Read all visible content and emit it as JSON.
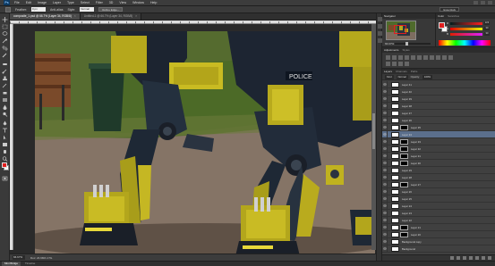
{
  "app": {
    "logo": "Ps"
  },
  "menu": [
    "File",
    "Edit",
    "Image",
    "Layer",
    "Type",
    "Select",
    "Filter",
    "3D",
    "View",
    "Window",
    "Help"
  ],
  "options": {
    "feather_label": "Feather:",
    "feather_value": "0 px",
    "antialias_label": "Anti-alias",
    "style_label": "Style:",
    "style_value": "Normal",
    "refine_button": "Refine Edge...",
    "workspace": "Essentials"
  },
  "tabs": [
    {
      "label": "composite_1.psd @ 66.7% (Layer 34, RGB/8)",
      "active": true
    },
    {
      "label": "Untitled-1 @ 66.7% (Layer 34, RGB/8)",
      "active": false
    }
  ],
  "status": {
    "zoom": "66.67%",
    "doc_info": "Doc: 24.9M/1.17G"
  },
  "bottom_tabs": [
    {
      "label": "Mini Bridge",
      "active": true
    },
    {
      "label": "Timeline",
      "active": false
    }
  ],
  "navigator": {
    "tab": "Navigator",
    "zoom": "66.67%"
  },
  "color_panel": {
    "tabs": [
      "Color",
      "Swatches"
    ],
    "sliders": [
      {
        "label": "R",
        "value": "223",
        "gradient": "linear-gradient(to right, #001e1e, #ff1e1e)"
      },
      {
        "label": "G",
        "value": "30",
        "gradient": "linear-gradient(to right, #e00000, #e0ff00)"
      },
      {
        "label": "B",
        "value": "30",
        "gradient": "linear-gradient(to right, #e01e00, #e01eff)"
      }
    ],
    "foreground": "#e01e1e",
    "background": "#ffffff"
  },
  "adjustments": {
    "tabs": [
      "Adjustments",
      "Styles"
    ]
  },
  "layers": {
    "tabs": [
      "Layers",
      "Channels",
      "Paths"
    ],
    "kind": "Kind",
    "mode": "Normal",
    "opacity_label": "Opacity:",
    "opacity": "100%",
    "lock_label": "Lock:",
    "fill_label": "Fill:",
    "fill": "100%",
    "items": [
      {
        "name": "Layer 41",
        "selected": false,
        "mask": false
      },
      {
        "name": "Layer 40",
        "selected": false,
        "mask": false
      },
      {
        "name": "Layer 39",
        "selected": false,
        "mask": false
      },
      {
        "name": "Layer 38",
        "selected": false,
        "mask": false
      },
      {
        "name": "Layer 37",
        "selected": false,
        "mask": false
      },
      {
        "name": "Layer 36",
        "selected": false,
        "mask": false
      },
      {
        "name": "Layer 35",
        "selected": false,
        "mask": true
      },
      {
        "name": "Layer 34",
        "selected": true,
        "mask": false
      },
      {
        "name": "Layer 33",
        "selected": false,
        "mask": true
      },
      {
        "name": "Layer 32",
        "selected": false,
        "mask": true
      },
      {
        "name": "Layer 31",
        "selected": false,
        "mask": true
      },
      {
        "name": "Layer 30",
        "selected": false,
        "mask": true
      },
      {
        "name": "Layer 29",
        "selected": false,
        "mask": false
      },
      {
        "name": "Layer 28",
        "selected": false,
        "mask": false
      },
      {
        "name": "Layer 27",
        "selected": false,
        "mask": true
      },
      {
        "name": "Layer 26",
        "selected": false,
        "mask": false
      },
      {
        "name": "Layer 25",
        "selected": false,
        "mask": false
      },
      {
        "name": "Layer 24",
        "selected": false,
        "mask": false
      },
      {
        "name": "Layer 23",
        "selected": false,
        "mask": false
      },
      {
        "name": "Layer 22",
        "selected": false,
        "mask": false
      },
      {
        "name": "Layer 21",
        "selected": false,
        "mask": true
      },
      {
        "name": "Layer 20",
        "selected": false,
        "mask": true
      },
      {
        "name": "Background copy",
        "selected": false,
        "mask": false
      },
      {
        "name": "Background",
        "selected": false,
        "mask": false
      }
    ]
  }
}
